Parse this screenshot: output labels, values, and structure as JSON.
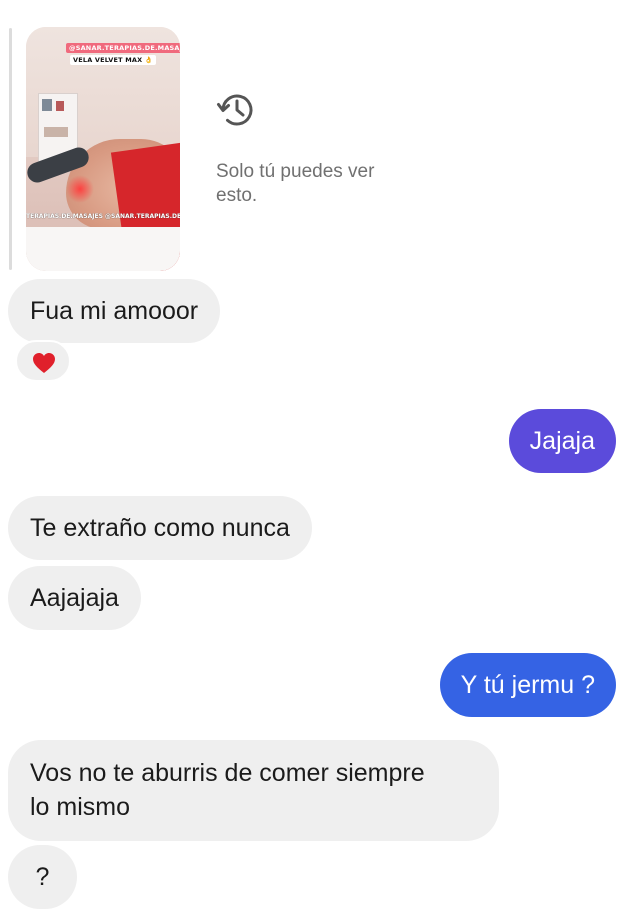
{
  "story_reply": {
    "thumbnail": {
      "overlay_handle": "@SANAR.TERAPIAS.DE.MASAJES ✨🍒",
      "overlay_product": "VELA VELVET MAX 👌",
      "watermark": "TERAPIAS.DE.MASAJES @SANAR.TERAPIAS.DE.MASAJES"
    },
    "history_icon": "history-icon",
    "note": "Solo tú puedes ver esto."
  },
  "messages": [
    {
      "sender": "them",
      "text": "Fua mi amooor",
      "reaction": "❤️"
    },
    {
      "sender": "me",
      "text": "Jajaja"
    },
    {
      "sender": "them",
      "text": "Te extraño como nunca"
    },
    {
      "sender": "them",
      "text": "Aajajaja"
    },
    {
      "sender": "me",
      "text": "Y tú jermu ?"
    },
    {
      "sender": "them",
      "text_line1": "Vos no te aburris de comer siempre",
      "text_line2": "lo mismo"
    },
    {
      "sender": "them",
      "text": "?"
    }
  ],
  "colors": {
    "incoming_bubble": "#efefef",
    "outgoing_purple": "#5b4bdb",
    "outgoing_blue": "#3563e4",
    "heart": "#e0202b"
  }
}
